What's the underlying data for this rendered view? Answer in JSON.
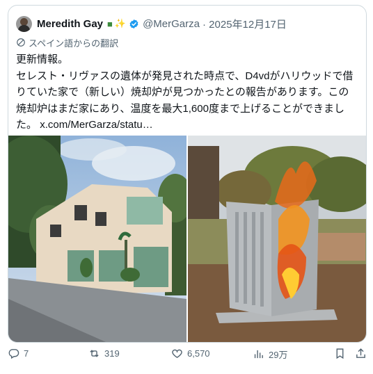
{
  "tweet": {
    "author_name": "Meredith Gay",
    "emojis": [
      "couch-emoji",
      "sparkles-emoji"
    ],
    "handle": "@MerGarza",
    "date": "· 2025年12月17日",
    "translated_label": "スペイン語からの翻訳",
    "lines": [
      "更新情報。",
      "セレスト・リヴァスの遺体が発見された時点で、D4vdがハリウッドで借",
      "りていた家で（新しい）焼却炉が見つかったとの報告があります。この",
      "焼却炉はまだ家にあり、温度を最大1,600度まで上げることができまし",
      "た。"
    ],
    "link": "x.com/MerGarza/statu…"
  },
  "media": [
    {
      "name": "house-photo",
      "icon": "house"
    },
    {
      "name": "incinerator-photo",
      "icon": "incinerator"
    }
  ],
  "actions": {
    "reply_count": "7",
    "repost_count": "319",
    "like_count": "6,570",
    "view_count": "29万"
  },
  "colors": {
    "verified": "#1d9bf0",
    "secondary_text": "#536471",
    "border": "#cfd9de"
  }
}
